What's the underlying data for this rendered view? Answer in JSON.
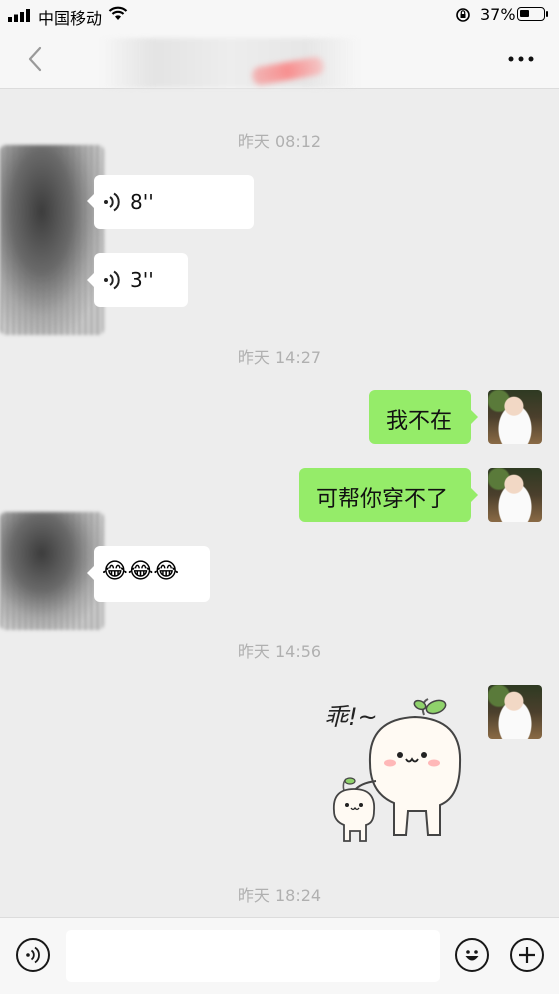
{
  "status_bar": {
    "carrier": "中国移动",
    "battery_percent": "37%",
    "battery_level": 0.37
  },
  "header": {
    "back_icon": "chevron-left-icon",
    "more_icon": "ellipsis-icon"
  },
  "messages": {
    "ts1": "昨天 08:12",
    "voice1_duration": "8''",
    "voice2_duration": "3''",
    "ts2": "昨天 14:27",
    "out1": "我不在",
    "out2": "可帮你穿不了",
    "in_emojis": "😂😂😂",
    "ts3": "昨天 14:56",
    "sticker_text": "乖!~",
    "ts4": "昨天 18:24"
  },
  "input_bar": {
    "voice_icon": "voice-icon",
    "emoji_icon": "emoji-icon",
    "plus_icon": "plus-icon"
  },
  "colors": {
    "bubble_out": "#95ec69",
    "bubble_in": "#ffffff",
    "background": "#ededed"
  }
}
